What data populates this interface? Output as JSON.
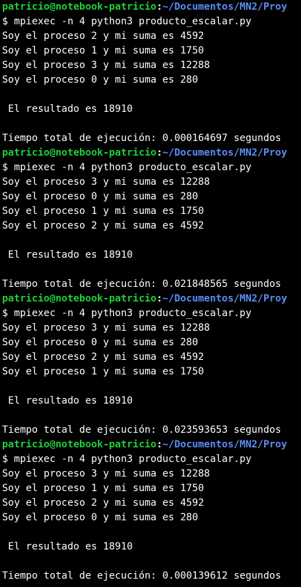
{
  "terminal": {
    "runs": [
      {
        "prompt": {
          "user_host": "patricio@notebook-patricio",
          "sep": ":",
          "path": "~/Documentos/MN2/Proy"
        },
        "command": "$ mpiexec -n 4 python3 producto_escalar.py",
        "outputs": [
          "Soy el proceso 2 y mi suma es 4592",
          "Soy el proceso 1 y mi suma es 1750",
          "Soy el proceso 3 y mi suma es 12288",
          "Soy el proceso 0 y mi suma es 280"
        ],
        "result": " El resultado es 18910",
        "time": "Tiempo total de ejecución: 0.000164697 segundos"
      },
      {
        "prompt": {
          "user_host": "patricio@notebook-patricio",
          "sep": ":",
          "path": "~/Documentos/MN2/Proy"
        },
        "command": "$ mpiexec -n 4 python3 producto_escalar.py",
        "outputs": [
          "Soy el proceso 3 y mi suma es 12288",
          "Soy el proceso 0 y mi suma es 280",
          "Soy el proceso 1 y mi suma es 1750",
          "Soy el proceso 2 y mi suma es 4592"
        ],
        "result": " El resultado es 18910",
        "time": "Tiempo total de ejecución: 0.021848565 segundos"
      },
      {
        "prompt": {
          "user_host": "patricio@notebook-patricio",
          "sep": ":",
          "path": "~/Documentos/MN2/Proy"
        },
        "command": "$ mpiexec -n 4 python3 producto_escalar.py",
        "outputs": [
          "Soy el proceso 3 y mi suma es 12288",
          "Soy el proceso 0 y mi suma es 280",
          "Soy el proceso 2 y mi suma es 4592",
          "Soy el proceso 1 y mi suma es 1750"
        ],
        "result": " El resultado es 18910",
        "time": "Tiempo total de ejecución: 0.023593653 segundos"
      },
      {
        "prompt": {
          "user_host": "patricio@notebook-patricio",
          "sep": ":",
          "path": "~/Documentos/MN2/Proy"
        },
        "command": "$ mpiexec -n 4 python3 producto_escalar.py",
        "outputs": [
          "Soy el proceso 3 y mi suma es 12288",
          "Soy el proceso 1 y mi suma es 1750",
          "Soy el proceso 2 y mi suma es 4592",
          "Soy el proceso 0 y mi suma es 280"
        ],
        "result": " El resultado es 18910",
        "time": "Tiempo total de ejecución: 0.000139612 segundos"
      }
    ]
  },
  "colors": {
    "background": "#000000",
    "text": "#ffffff",
    "prompt_user": "#1fd13a",
    "prompt_path": "#5c8df6"
  }
}
